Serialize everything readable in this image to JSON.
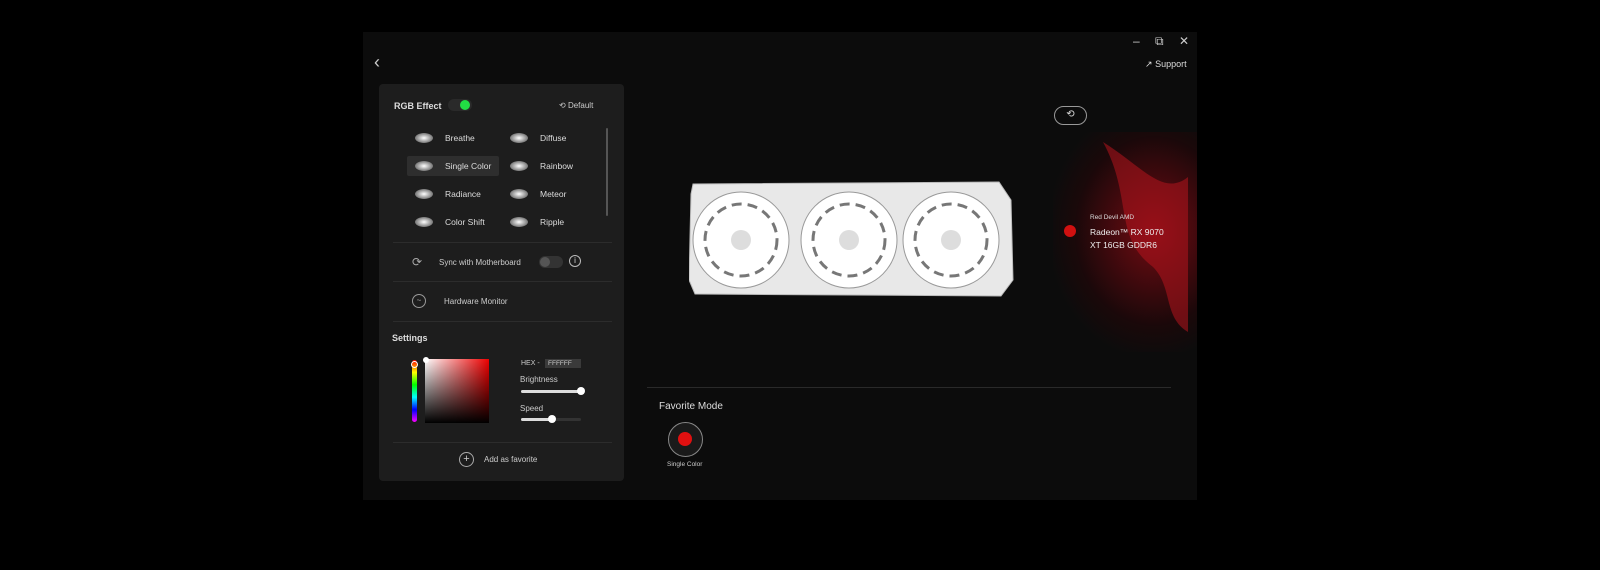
{
  "window": {
    "minimize": "–",
    "restore": "⧉",
    "close": "✕",
    "back": "‹",
    "support": "Support"
  },
  "panel": {
    "rgb_effect_label": "RGB Effect",
    "rgb_effect_on": true,
    "default_label": "Default",
    "effects": [
      {
        "label": "Breathe",
        "icon": "breathe-icon"
      },
      {
        "label": "Diffuse",
        "icon": "diffuse-icon"
      },
      {
        "label": "Single Color",
        "icon": "single-color-icon",
        "selected": true
      },
      {
        "label": "Rainbow",
        "icon": "rainbow-icon"
      },
      {
        "label": "Radiance",
        "icon": "radiance-icon"
      },
      {
        "label": "Meteor",
        "icon": "meteor-icon"
      },
      {
        "label": "Color Shift",
        "icon": "color-shift-icon"
      },
      {
        "label": "Ripple",
        "icon": "ripple-icon"
      }
    ],
    "sync_label": "Sync with Motherboard",
    "sync_on": false,
    "hardware_monitor_label": "Hardware Monitor",
    "settings_label": "Settings",
    "hex_label": "HEX -",
    "hex_value": "FFFFFF",
    "brightness_label": "Brightness",
    "brightness": 1.0,
    "speed_label": "Speed",
    "speed": 0.5,
    "add_favorite_label": "Add as favorite"
  },
  "device": {
    "brand": "Red Devil AMD",
    "model_line1": "Radeon™ RX 9070",
    "model_line2": "XT 16GB GDDR6",
    "color": "#d01010"
  },
  "favorite": {
    "title": "Favorite Mode",
    "items": [
      {
        "label": "Single Color",
        "color": "#e01010"
      }
    ]
  },
  "colors": {
    "accent_green": "#22dd44",
    "panel": "#1d1d1d"
  }
}
